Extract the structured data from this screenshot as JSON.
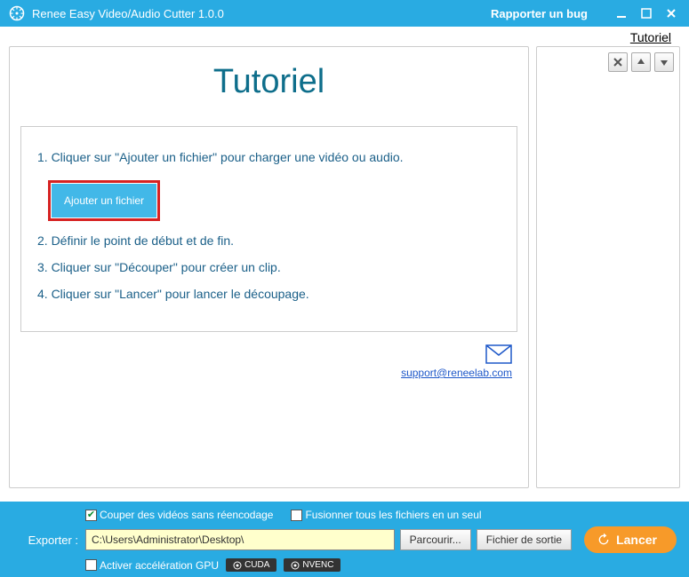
{
  "titlebar": {
    "title": "Renee Easy Video/Audio Cutter 1.0.0",
    "report_bug": "Rapporter un bug"
  },
  "toplink": "Tutoriel",
  "tutorial": {
    "heading": "Tutoriel",
    "step1": "1. Cliquer sur \"Ajouter un fichier\" pour charger une vidéo ou audio.",
    "add_button": "Ajouter un fichier",
    "step2": "2. Définir le point de début et de fin.",
    "step3": "3. Cliquer sur \"Découper\" pour créer un clip.",
    "step4": "4. Cliquer sur \"Lancer\" pour lancer le découpage.",
    "support_email": "support@reneelab.com"
  },
  "bottom": {
    "cut_no_reencode": "Couper des vidéos sans réencodage",
    "merge_all": "Fusionner tous les fichiers en un seul",
    "export_label": "Exporter :",
    "export_path": "C:\\Users\\Administrator\\Desktop\\",
    "browse": "Parcourir...",
    "output_file": "Fichier de sortie",
    "launch": "Lancer",
    "gpu_accel": "Activer accélération GPU",
    "cuda": "CUDA",
    "nvenc": "NVENC"
  }
}
